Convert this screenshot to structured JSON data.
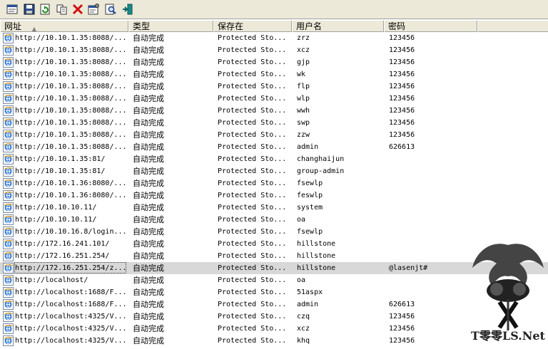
{
  "toolbar": {
    "buttons": [
      {
        "name": "html-report-icon"
      },
      {
        "name": "save-icon"
      },
      {
        "name": "refresh-icon"
      },
      {
        "name": "copy-icon"
      },
      {
        "name": "delete-icon"
      },
      {
        "name": "properties-icon"
      },
      {
        "name": "find-icon"
      },
      {
        "name": "exit-icon"
      }
    ]
  },
  "columns": {
    "url": "网址",
    "type": "类型",
    "stored": "保存在",
    "user": "用户名",
    "password": "密码"
  },
  "rows": [
    {
      "url": "http://10.10.1.35:8088/...",
      "type": "自动完成",
      "stored": "Protected Sto...",
      "user": "zrz",
      "password": "123456"
    },
    {
      "url": "http://10.10.1.35:8088/...",
      "type": "自动完成",
      "stored": "Protected Sto...",
      "user": "xcz",
      "password": "123456"
    },
    {
      "url": "http://10.10.1.35:8088/...",
      "type": "自动完成",
      "stored": "Protected Sto...",
      "user": "gjp",
      "password": "123456"
    },
    {
      "url": "http://10.10.1.35:8088/...",
      "type": "自动完成",
      "stored": "Protected Sto...",
      "user": "wk",
      "password": "123456"
    },
    {
      "url": "http://10.10.1.35:8088/...",
      "type": "自动完成",
      "stored": "Protected Sto...",
      "user": "flp",
      "password": "123456"
    },
    {
      "url": "http://10.10.1.35:8088/...",
      "type": "自动完成",
      "stored": "Protected Sto...",
      "user": "wlp",
      "password": "123456"
    },
    {
      "url": "http://10.10.1.35:8088/...",
      "type": "自动完成",
      "stored": "Protected Sto...",
      "user": "wwh",
      "password": "123456"
    },
    {
      "url": "http://10.10.1.35:8088/...",
      "type": "自动完成",
      "stored": "Protected Sto...",
      "user": "swp",
      "password": "123456"
    },
    {
      "url": "http://10.10.1.35:8088/...",
      "type": "自动完成",
      "stored": "Protected Sto...",
      "user": "zzw",
      "password": "123456"
    },
    {
      "url": "http://10.10.1.35:8088/...",
      "type": "自动完成",
      "stored": "Protected Sto...",
      "user": "admin",
      "password": "626613"
    },
    {
      "url": "http://10.10.1.35:81/",
      "type": "自动完成",
      "stored": "Protected Sto...",
      "user": "changhaijun",
      "password": ""
    },
    {
      "url": "http://10.10.1.35:81/",
      "type": "自动完成",
      "stored": "Protected Sto...",
      "user": "group-admin",
      "password": ""
    },
    {
      "url": "http://10.10.1.36:8080/...",
      "type": "自动完成",
      "stored": "Protected Sto...",
      "user": "fsewlp",
      "password": ""
    },
    {
      "url": "http://10.10.1.36:8080/...",
      "type": "自动完成",
      "stored": "Protected Sto...",
      "user": "feswlp",
      "password": ""
    },
    {
      "url": "http://10.10.10.11/",
      "type": "自动完成",
      "stored": "Protected Sto...",
      "user": "system",
      "password": ""
    },
    {
      "url": "http://10.10.10.11/",
      "type": "自动完成",
      "stored": "Protected Sto...",
      "user": "oa",
      "password": ""
    },
    {
      "url": "http://10.10.16.8/login...",
      "type": "自动完成",
      "stored": "Protected Sto...",
      "user": "fsewlp",
      "password": ""
    },
    {
      "url": "http://172.16.241.101/",
      "type": "自动完成",
      "stored": "Protected Sto...",
      "user": "hillstone",
      "password": ""
    },
    {
      "url": "http://172.16.251.254/",
      "type": "自动完成",
      "stored": "Protected Sto...",
      "user": "hillstone",
      "password": ""
    },
    {
      "url": "http://172.16.251.254/z...",
      "type": "自动完成",
      "stored": "Protected Sto...",
      "user": "hillstone",
      "password": "@lasenjt#",
      "selected": true
    },
    {
      "url": "http://localhost/",
      "type": "自动完成",
      "stored": "Protected Sto...",
      "user": "oa",
      "password": ""
    },
    {
      "url": "http://localhost:1688/F...",
      "type": "自动完成",
      "stored": "Protected Sto...",
      "user": "51aspx",
      "password": ""
    },
    {
      "url": "http://localhost:1688/F...",
      "type": "自动完成",
      "stored": "Protected Sto...",
      "user": "admin",
      "password": "626613"
    },
    {
      "url": "http://localhost:4325/V...",
      "type": "自动完成",
      "stored": "Protected Sto...",
      "user": "czq",
      "password": "123456"
    },
    {
      "url": "http://localhost:4325/V...",
      "type": "自动完成",
      "stored": "Protected Sto...",
      "user": "xcz",
      "password": "123456"
    },
    {
      "url": "http://localhost:4325/V...",
      "type": "自动完成",
      "stored": "Protected Sto...",
      "user": "khq",
      "password": "123456"
    }
  ],
  "watermark": {
    "text": "T零零LS.Net"
  }
}
